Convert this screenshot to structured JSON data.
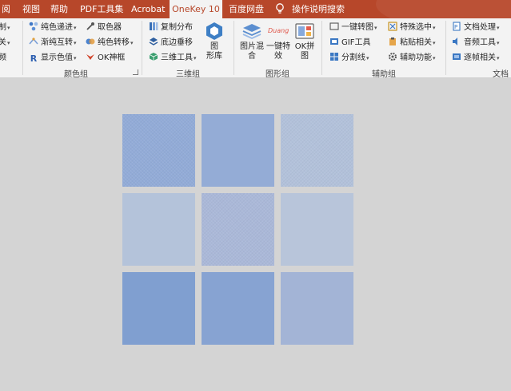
{
  "tabs": {
    "view_partial": "阅",
    "view": "视图",
    "help": "帮助",
    "pdf": "PDF工具集",
    "acrobat": "Acrobat",
    "onekey": "OneKey 10",
    "baidu": "百度网盘",
    "search": "操作说明搜索"
  },
  "colors": {
    "tab_bar": "#b7472a",
    "ribbon": "#f3f3f3",
    "canvas": "#d4d4d4"
  },
  "ribbon": {
    "left_partial": {
      "r1": "制",
      "r2": "关",
      "r3": "频"
    },
    "color_group": {
      "label": "颜色组",
      "col1": [
        "纯色递进",
        "渐纯互转",
        "显示色值"
      ],
      "col2": [
        "取色器",
        "纯色转移",
        "OK神框"
      ]
    },
    "three_d_group": {
      "label": "三维组",
      "items": [
        "复制分布",
        "底边垂移",
        "三维工具"
      ],
      "big_button": [
        "图",
        "形库"
      ]
    },
    "shape_group": {
      "label": "图形组",
      "btn1": [
        "图片混",
        "合"
      ],
      "btn2": [
        "一键特",
        "效"
      ],
      "btn3": [
        "OK拼",
        "图"
      ],
      "duang": "Duang"
    },
    "aux_group": {
      "label": "辅助组",
      "col1": [
        "一键转图",
        "GIF工具",
        "分割线"
      ],
      "col2": [
        "特殊选中",
        "粘贴相关",
        "辅助功能"
      ]
    },
    "doc_group": {
      "label": "文档",
      "items": [
        "文档处理",
        "音频工具",
        "逐帧相关"
      ]
    }
  },
  "tiles": [
    {
      "color": "#92abd7"
    },
    {
      "color": "#94acd6"
    },
    {
      "color": "#b2c1da"
    },
    {
      "color": "#b4c3da"
    },
    {
      "color": "#aab8d8"
    },
    {
      "color": "#b8c5da"
    },
    {
      "color": "#809fd0"
    },
    {
      "color": "#87a3d2"
    },
    {
      "color": "#a3b4d6"
    }
  ]
}
